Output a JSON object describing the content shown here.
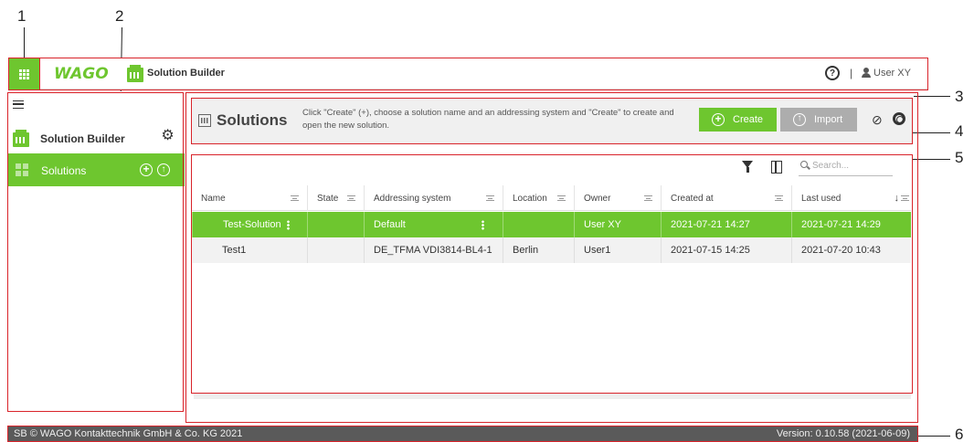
{
  "callouts": [
    "1",
    "2",
    "3",
    "4",
    "5",
    "6"
  ],
  "colors": {
    "accent": "#6ec62f",
    "frame": "#d9232a",
    "footer": "#5a5a5a",
    "disabled": "#adadad"
  },
  "topbar": {
    "brand": "WAGO",
    "app_title": "Solution Builder",
    "help_glyph": "?",
    "separator": "|",
    "user": "User XY",
    "icons": [
      "apps-grid-icon",
      "app-icon",
      "help-icon",
      "user-icon"
    ]
  },
  "sidebar": {
    "app_label": "Solution Builder",
    "items": [
      {
        "label": "Solutions",
        "icon": "dashboard-icon",
        "actions": [
          "add-circle-icon",
          "upload-circle-icon"
        ]
      }
    ]
  },
  "header": {
    "title": "Solutions",
    "hint": "Click \"Create\" (+), choose a solution name and an addressing system and \"Create\" to create and open the new solution.",
    "create_label": "Create",
    "import_label": "Import",
    "create_glyph": "+",
    "import_glyph": "↑",
    "icons": [
      "solutions-icon",
      "visibility-off-icon",
      "support-icon"
    ]
  },
  "search": {
    "placeholder": "Search..."
  },
  "table": {
    "columns": [
      "Name",
      "State",
      "Addressing system",
      "Location",
      "Owner",
      "Created at",
      "Last used"
    ],
    "sorted_column": "Last used",
    "sort_direction": "descending",
    "sort_glyph": "↓",
    "rows": [
      {
        "name": "Test-Solution",
        "state": "",
        "addressing": "Default",
        "location": "",
        "owner": "User XY",
        "created": "2021-07-21 14:27",
        "last_used": "2021-07-21 14:29",
        "selected": true
      },
      {
        "name": "Test1",
        "state": "",
        "addressing": "DE_TFMA VDI3814-BL4-1",
        "location": "Berlin",
        "owner": "User1",
        "created": "2021-07-15 14:25",
        "last_used": "2021-07-20 10:43",
        "selected": false
      }
    ]
  },
  "footer": {
    "copyright": "SB © WAGO Kontakttechnik GmbH & Co. KG 2021",
    "version": "Version: 0.10.58 (2021-06-09)"
  }
}
